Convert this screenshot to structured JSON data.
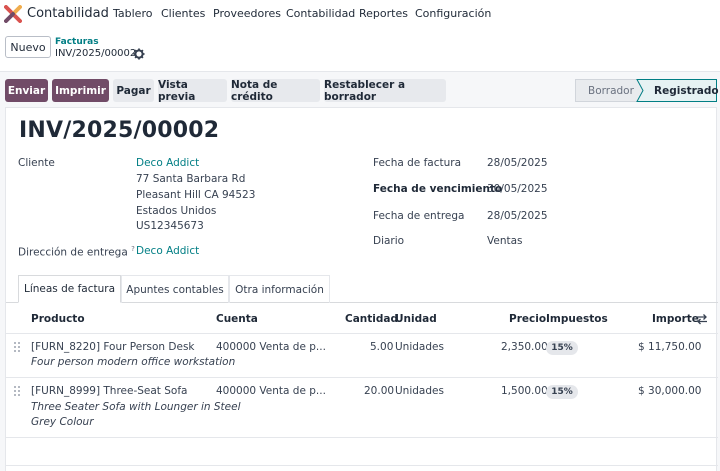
{
  "app": {
    "name": "Contabilidad"
  },
  "nav": [
    "Tablero",
    "Clientes",
    "Proveedores",
    "Contabilidad",
    "Reportes",
    "Configuración"
  ],
  "control": {
    "new_label": "Nuevo",
    "breadcrumb_parent": "Facturas",
    "breadcrumb_current": "INV/2025/00002"
  },
  "actions": {
    "send": "Enviar",
    "print": "Imprimir",
    "pay": "Pagar",
    "preview": "Vista previa",
    "credit_note": "Nota de crédito",
    "reset": "Restablecer a borrador"
  },
  "status": {
    "draft": "Borrador",
    "posted": "Registrado"
  },
  "form": {
    "title": "INV/2025/00002",
    "customer_label": "Cliente",
    "customer_name": "Deco Addict",
    "address_lines": [
      "77 Santa Barbara Rd",
      "Pleasant Hill CA 94523",
      "Estados Unidos",
      "US12345673"
    ],
    "delivery_label": "Dirección de entrega",
    "delivery_help": "?",
    "delivery_value": "Deco Addict",
    "invoice_date_label": "Fecha de factura",
    "invoice_date": "28/05/2025",
    "due_date_label": "Fecha de vencimiento",
    "due_date": "30/05/2025",
    "delivery_date_label": "Fecha de entrega",
    "delivery_date": "28/05/2025",
    "journal_label": "Diario",
    "journal": "Ventas"
  },
  "tabs": [
    "Líneas de factura",
    "Apuntes contables",
    "Otra información"
  ],
  "table": {
    "headers": {
      "product": "Producto",
      "account": "Cuenta",
      "quantity": "Cantidad",
      "unit": "Unidad",
      "price": "Precio",
      "taxes": "Impuestos",
      "amount": "Importe"
    },
    "rows": [
      {
        "product": "[FURN_8220] Four Person Desk",
        "description": [
          "Four person modern office workstation"
        ],
        "account": "400000 Venta de p...",
        "quantity": "5.00",
        "unit": "Unidades",
        "price": "2,350.00",
        "tax": "15%",
        "amount": "$ 11,750.00"
      },
      {
        "product": "[FURN_8999] Three-Seat Sofa",
        "description": [
          "Three Seater Sofa with Lounger in Steel",
          "Grey Colour"
        ],
        "account": "400000 Venta de p...",
        "quantity": "20.00",
        "unit": "Unidades",
        "price": "1,500.00",
        "tax": "15%",
        "amount": "$ 30,000.00"
      }
    ]
  },
  "colors": {
    "primary": "#714b67",
    "link": "#017e84",
    "status_active": "#e6f2f3"
  }
}
